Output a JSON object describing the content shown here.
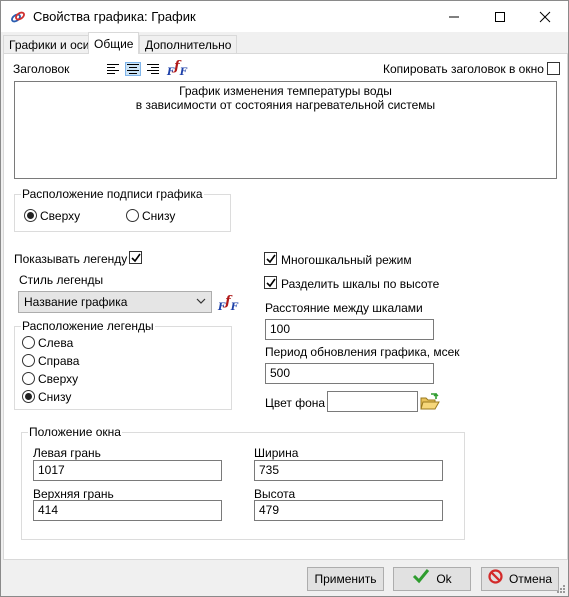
{
  "window": {
    "title": "Свойства графика: График"
  },
  "tabs": [
    {
      "label": "Графики и оси",
      "active": false
    },
    {
      "label": "Общие",
      "active": true
    },
    {
      "label": "Дополнительно",
      "active": false
    }
  ],
  "header": {
    "label": "Заголовок",
    "copy_title_label": "Копировать заголовок в окно",
    "copy_title_checked": false,
    "text_line1": "График изменения температуры воды",
    "text_line2": "в зависимости от состояния нагревательной системы",
    "alignment": "center"
  },
  "caption_position": {
    "title": "Расположение подписи графика",
    "options": [
      {
        "label": "Сверху",
        "selected": true
      },
      {
        "label": "Снизу",
        "selected": false
      }
    ]
  },
  "legend": {
    "show_label": "Показывать легенду",
    "show_checked": true,
    "style_label": "Стиль легенды",
    "style_value": "Название графика",
    "position_title": "Расположение легенды",
    "positions": [
      {
        "label": "Слева",
        "selected": false
      },
      {
        "label": "Справа",
        "selected": false
      },
      {
        "label": "Сверху",
        "selected": false
      },
      {
        "label": "Снизу",
        "selected": true
      }
    ]
  },
  "options": {
    "multiscale_label": "Многошкальный режим",
    "multiscale_checked": true,
    "split_label": "Разделить шкалы по высоте",
    "split_checked": true,
    "scale_distance_label": "Расстояние между шкалами",
    "scale_distance_value": "100",
    "refresh_label": "Период обновления графика, мсек",
    "refresh_value": "500",
    "bg_color_label": "Цвет фона",
    "bg_color_value": ""
  },
  "window_position": {
    "title": "Положение окна",
    "left_label": "Левая грань",
    "left_value": "1017",
    "width_label": "Ширина",
    "width_value": "735",
    "top_label": "Верхняя грань",
    "top_value": "414",
    "height_label": "Высота",
    "height_value": "479"
  },
  "buttons": {
    "apply": "Применить",
    "ok": "Ok",
    "cancel": "Отмена"
  },
  "icons": {
    "app": "chart-link-icon",
    "align_left": "align-left-icon",
    "align_center": "align-center-icon",
    "align_right": "align-right-icon",
    "formula": "formula-icon",
    "folder": "open-folder-icon",
    "ok": "green-checkmark-icon",
    "cancel": "red-cancel-icon"
  },
  "colors": {
    "ok_green": "#2e9c2e",
    "cancel_red": "#d32a2a",
    "formula_blue": "#1c3fa8",
    "formula_red": "#b01818",
    "align_highlight": "#cce4f7"
  }
}
